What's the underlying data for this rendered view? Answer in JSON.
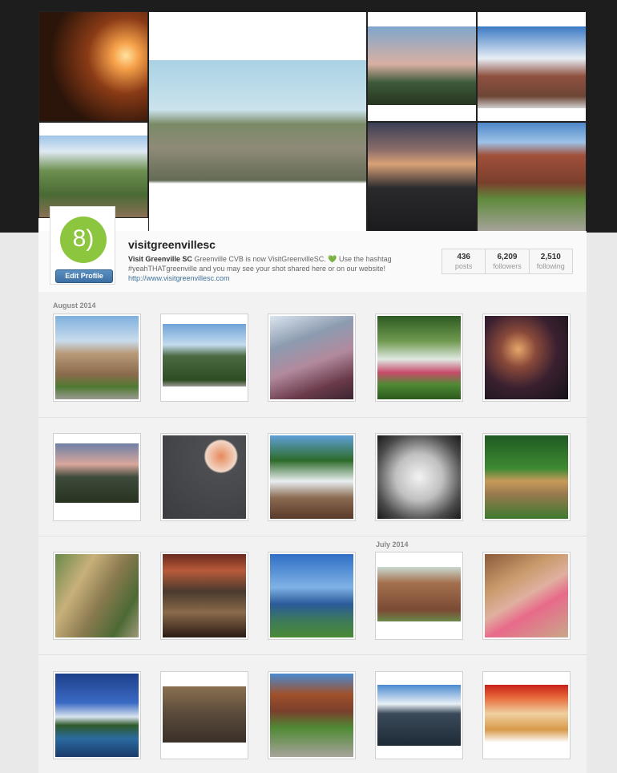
{
  "profile": {
    "username": "visitgreenvillesc",
    "display_name": "Visit Greenville SC",
    "bio_text": "Greenville CVB is now VisitGreenvilleSC.",
    "bio_heart": "💚",
    "bio_text2": "Use the hashtag #yeahTHATgreenville and you may see your shot shared here or on our website!",
    "website": "http://www.visitgreenvillesc.com",
    "edit_label": "Edit Profile",
    "avatar_glyph": "8)",
    "avatar_color": "#8cc63f"
  },
  "stats": [
    {
      "value": "436",
      "label": "posts"
    },
    {
      "value": "6,209",
      "label": "followers"
    },
    {
      "value": "2,510",
      "label": "following"
    }
  ],
  "sections": {
    "august": "August 2014",
    "july": "July 2014"
  },
  "colors": {
    "link": "#3f729b",
    "button": "#3c6fa3",
    "heart": "#3aa35a"
  }
}
